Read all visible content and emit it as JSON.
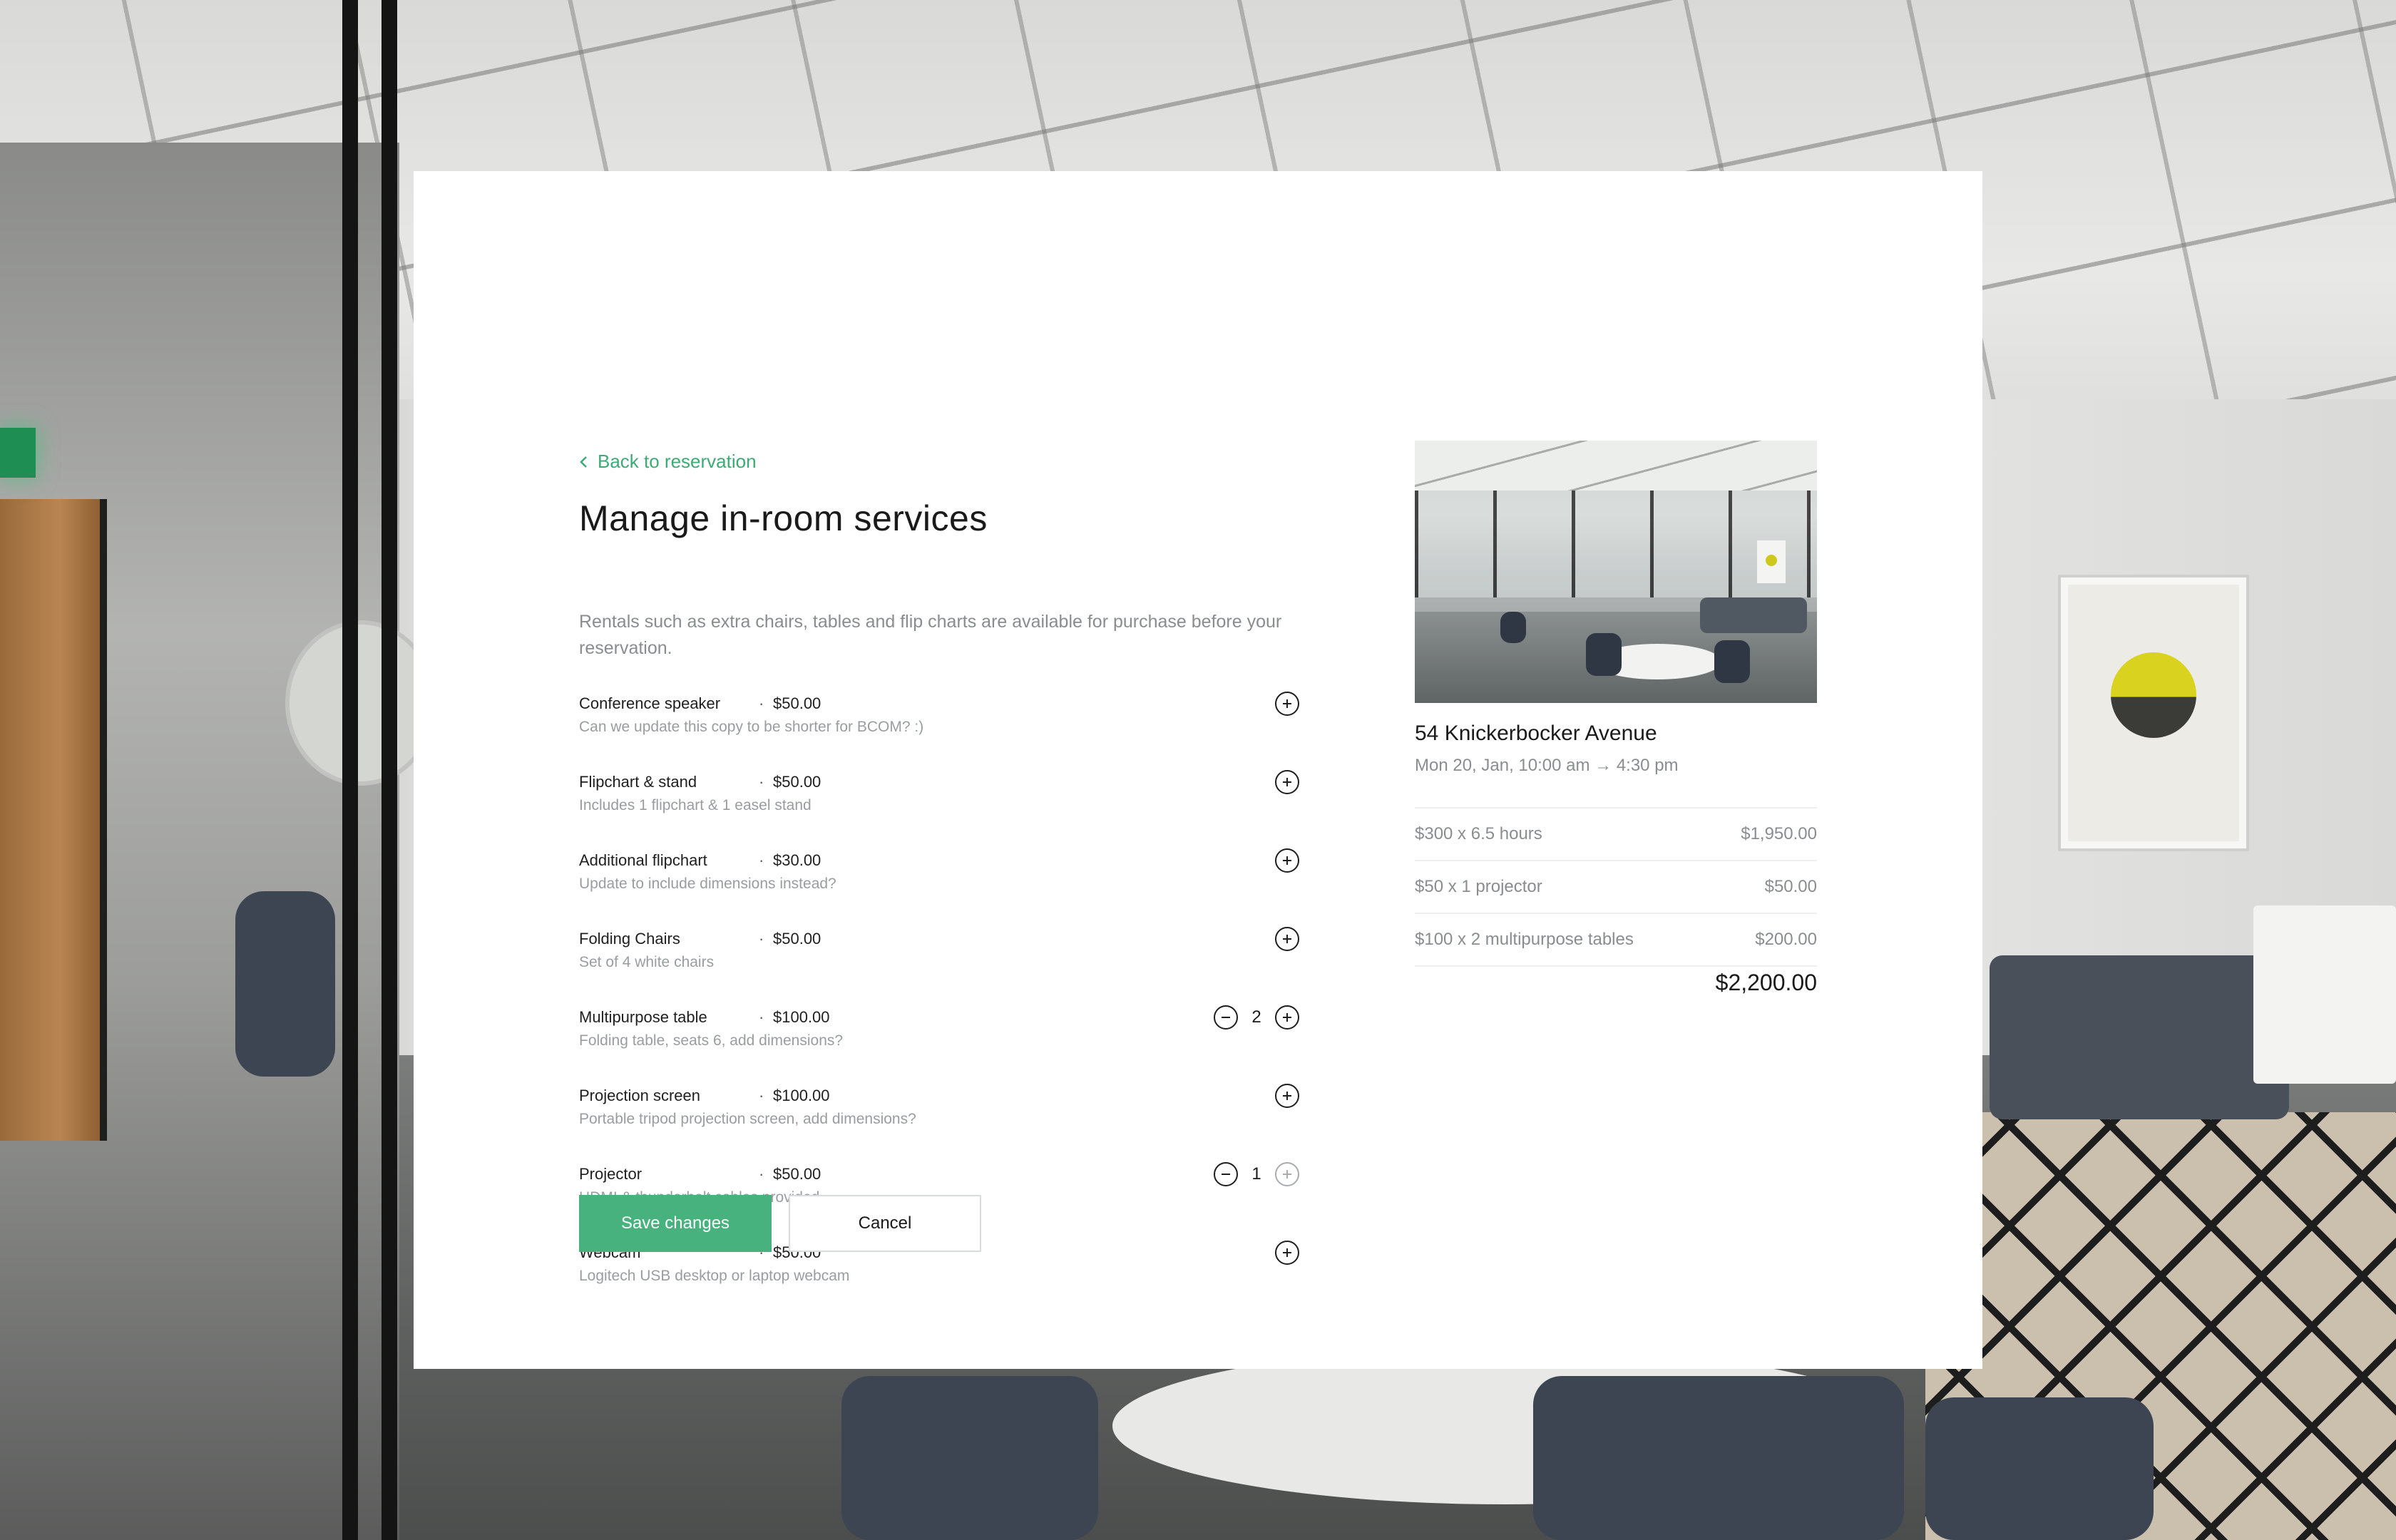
{
  "back_link": {
    "label": "Back to reservation"
  },
  "page_title": "Manage in-room services",
  "intro": "Rentals such as extra chairs, tables and flip charts are available for purchase before your reservation.",
  "services": [
    {
      "name": "Conference speaker",
      "price": "$50.00",
      "description": "Can we update this copy to be shorter for BCOM? :)",
      "quantity": null
    },
    {
      "name": "Flipchart & stand",
      "price": "$50.00",
      "description": "Includes 1 flipchart & 1 easel stand",
      "quantity": null
    },
    {
      "name": "Additional flipchart",
      "price": "$30.00",
      "description": "Update to include dimensions instead?",
      "quantity": null
    },
    {
      "name": "Folding Chairs",
      "price": "$50.00",
      "description": "Set of 4 white chairs",
      "quantity": null
    },
    {
      "name": "Multipurpose table",
      "price": "$100.00",
      "description": "Folding table, seats 6, add dimensions?",
      "quantity": "2"
    },
    {
      "name": "Projection screen",
      "price": "$100.00",
      "description": "Portable tripod projection screen, add dimensions?",
      "quantity": null
    },
    {
      "name": "Projector",
      "price": "$50.00",
      "description": "HDMI & thunderbolt cables provided",
      "quantity": "1",
      "increment_disabled": true
    },
    {
      "name": "Webcam",
      "price": "$50.00",
      "description": "Logitech USB desktop or laptop webcam",
      "quantity": null
    }
  ],
  "separator": "·",
  "actions": {
    "save_label": "Save changes",
    "cancel_label": "Cancel"
  },
  "summary": {
    "venue_name": "54 Knickerbocker Avenue",
    "venue_time": "Mon 20, Jan, 10:00 am → 4:30 pm",
    "line_items": [
      {
        "label": "$300 x 6.5 hours",
        "amount": "$1,950.00"
      },
      {
        "label": "$50 x 1 projector",
        "amount": "$50.00"
      },
      {
        "label": "$100 x 2 multipurpose tables",
        "amount": "$200.00"
      }
    ],
    "total": "$2,200.00"
  },
  "colors": {
    "accent": "#47b27d",
    "link": "#3dab75",
    "muted_text": "#8a8d8f"
  },
  "icons": {
    "back": "chevron-left-icon",
    "increment": "plus-circle-icon",
    "decrement": "minus-circle-icon"
  }
}
